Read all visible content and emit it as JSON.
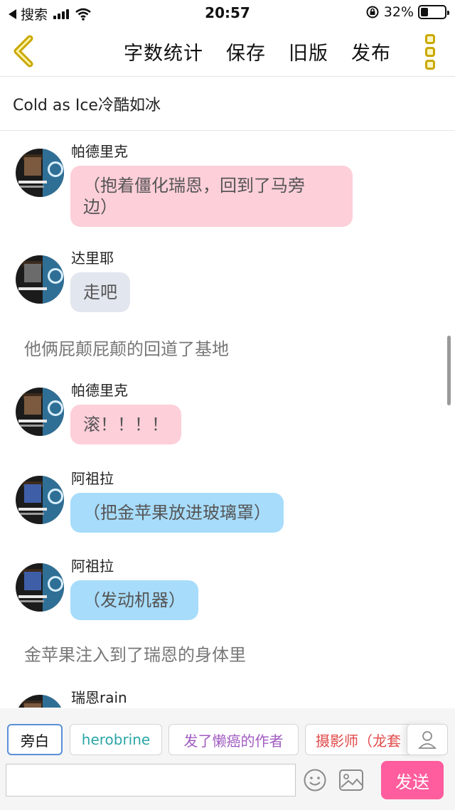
{
  "status_bar": {
    "carrier": "搜索",
    "time": "20:57",
    "battery_percent": "32%",
    "battery_level": 0.32
  },
  "nav": {
    "actions": [
      "字数统计",
      "保存",
      "旧版",
      "发布"
    ],
    "accent_color": "#c9a800"
  },
  "story": {
    "title": "Cold as Ice冷酷如冰"
  },
  "messages": [
    {
      "type": "dialog",
      "speaker": "帕德里克",
      "text": "（抱着僵化瑞恩，回到了马旁",
      "text2": "边）",
      "bubble_color": "pink"
    },
    {
      "type": "dialog",
      "speaker": "达里耶",
      "text": "走吧",
      "bubble_color": "gray"
    },
    {
      "type": "narration",
      "text": "他俩屁颠屁颠的回道了基地"
    },
    {
      "type": "dialog",
      "speaker": "帕德里克",
      "text": "滚！！！！",
      "bubble_color": "pink"
    },
    {
      "type": "dialog",
      "speaker": "阿祖拉",
      "text": "（把金苹果放进玻璃罩）",
      "bubble_color": "blue"
    },
    {
      "type": "dialog",
      "speaker": "阿祖拉",
      "text": "（发动机器）",
      "bubble_color": "blue"
    },
    {
      "type": "narration",
      "text": "金苹果注入到了瑞恩的身体里"
    },
    {
      "type": "dialog",
      "speaker": "瑞恩rain",
      "text": "",
      "bubble_color": "none"
    }
  ],
  "roles": [
    {
      "label": "旁白",
      "state": "selected"
    },
    {
      "label": "herobrine",
      "color": "#2ba6a6"
    },
    {
      "label": "发了懒癌的作者",
      "color": "#a15cc1"
    },
    {
      "label": "摄影师（龙套",
      "color": "#e04a4a"
    }
  ],
  "composer": {
    "input_value": "",
    "input_placeholder": "",
    "send_label": "发送",
    "send_color": "#ff5d9e"
  },
  "icons": {
    "back": "back-chevron-icon",
    "more": "more-vertical-icon",
    "emoji": "emoji-icon",
    "image": "image-icon",
    "profile": "person-icon"
  }
}
